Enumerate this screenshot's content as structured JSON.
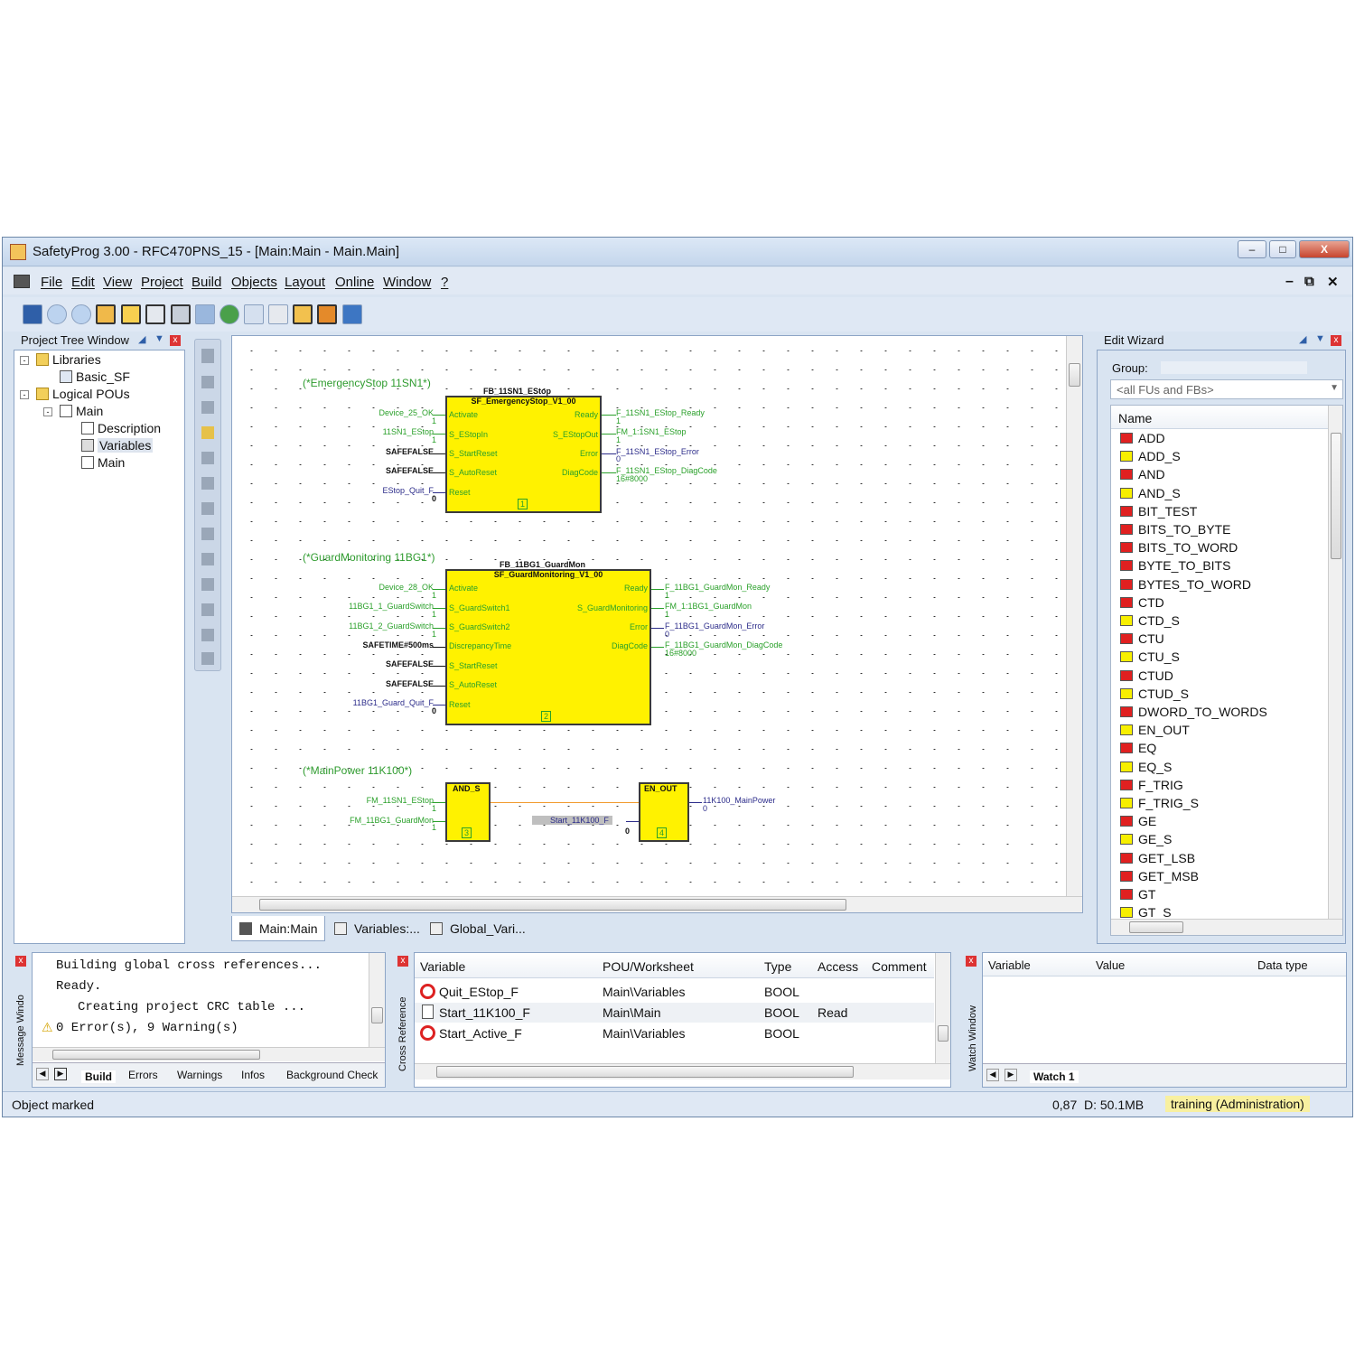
{
  "window": {
    "title": "SafetyProg 3.00 - RFC470PNS_15 - [Main:Main - Main.Main]",
    "controls": {
      "minimize": "–",
      "maximize": "□",
      "close": "X"
    }
  },
  "menu": {
    "items": [
      "File",
      "Edit",
      "View",
      "Project",
      "Build",
      "Objects",
      "Layout",
      "Online",
      "Window",
      "?"
    ],
    "mdi_controls": {
      "minimize": "–",
      "restore": "⧉",
      "close": "✕"
    }
  },
  "project_tree": {
    "title": "Project Tree Window",
    "nodes": {
      "libraries": "Libraries",
      "basic_sf": "Basic_SF",
      "logical_pous": "Logical POUs",
      "main": "Main",
      "description": "Description",
      "variables": "Variables",
      "main_sheet": "Main"
    }
  },
  "editor": {
    "networks": {
      "estop": {
        "comment": "(*EmergencyStop 11SN1*)",
        "instance": "FB_11SN1_EStop",
        "type": "SF_EmergencyStop_V1_00",
        "number": "1",
        "inputs": [
          {
            "var": "Device_25_OK",
            "pin": "Activate",
            "val": "1"
          },
          {
            "var": "11SN1_EStop",
            "pin": "S_EStopIn",
            "val": "1"
          },
          {
            "var": "SAFEFALSE",
            "pin": "S_StartReset",
            "val": ""
          },
          {
            "var": "SAFEFALSE",
            "pin": "S_AutoReset",
            "val": ""
          },
          {
            "var": "EStop_Quit_F",
            "pin": "Reset",
            "val": "0"
          }
        ],
        "outputs": [
          {
            "pin": "Ready",
            "var": "F_11SN1_EStop_Ready",
            "val": "1"
          },
          {
            "pin": "S_EStopOut",
            "var": "FM_1:1SN1_EStop",
            "val": "1"
          },
          {
            "pin": "Error",
            "var": "F_11SN1_EStop_Error",
            "val": "0"
          },
          {
            "pin": "DiagCode",
            "var": "F_11SN1_EStop_DiagCode",
            "val": "16#8000"
          }
        ]
      },
      "guard": {
        "comment": "(*GuardMonitoring 11BG1*)",
        "instance": "FB_11BG1_GuardMon",
        "type": "SF_GuardMonitoring_V1_00",
        "number": "2",
        "inputs": [
          {
            "var": "Device_28_OK",
            "pin": "Activate",
            "val": "1"
          },
          {
            "var": "11BG1_1_GuardSwitch",
            "pin": "S_GuardSwitch1",
            "val": "1"
          },
          {
            "var": "11BG1_2_GuardSwitch",
            "pin": "S_GuardSwitch2",
            "val": "1"
          },
          {
            "var": "SAFETIME#500ms",
            "pin": "DiscrepancyTime",
            "val": ""
          },
          {
            "var": "SAFEFALSE",
            "pin": "S_StartReset",
            "val": ""
          },
          {
            "var": "SAFEFALSE",
            "pin": "S_AutoReset",
            "val": ""
          },
          {
            "var": "11BG1_Guard_Quit_F",
            "pin": "Reset",
            "val": "0"
          }
        ],
        "outputs": [
          {
            "pin": "Ready",
            "var": "F_11BG1_GuardMon_Ready",
            "val": "1"
          },
          {
            "pin": "S_GuardMonitoring",
            "var": "FM_1:1BG1_GuardMon",
            "val": "1"
          },
          {
            "pin": "Error",
            "var": "F_11BG1_GuardMon_Error",
            "val": "0"
          },
          {
            "pin": "DiagCode",
            "var": "F_11BG1_GuardMon_DiagCode",
            "val": "16#8000"
          }
        ]
      },
      "mainpower": {
        "comment": "(*MainPower 11K100*)",
        "and_label": "AND_S",
        "and_number": "3",
        "and_in1": "FM_11SN1_EStop",
        "and_in1_val": "1",
        "and_in2": "FM_11BG1_GuardMon",
        "and_in2_val": "1",
        "en_label": "EN_OUT",
        "en_number": "4",
        "en_in": "Start_11K100_F",
        "en_in_val": "0",
        "en_out": "11K100_MainPower",
        "en_out_val": "0"
      }
    },
    "tabs": [
      "Main:Main",
      "Variables:...",
      "Global_Vari..."
    ]
  },
  "edit_wizard": {
    "title": "Edit Wizard",
    "group_label": "Group:",
    "group_value": "<all FUs and FBs>",
    "column_name": "Name",
    "items": [
      {
        "name": "ADD",
        "color": "red"
      },
      {
        "name": "ADD_S",
        "color": "yellow"
      },
      {
        "name": "AND",
        "color": "red"
      },
      {
        "name": "AND_S",
        "color": "yellow"
      },
      {
        "name": "BIT_TEST",
        "color": "red"
      },
      {
        "name": "BITS_TO_BYTE",
        "color": "red"
      },
      {
        "name": "BITS_TO_WORD",
        "color": "red"
      },
      {
        "name": "BYTE_TO_BITS",
        "color": "red"
      },
      {
        "name": "BYTES_TO_WORD",
        "color": "red"
      },
      {
        "name": "CTD",
        "color": "red"
      },
      {
        "name": "CTD_S",
        "color": "yellow"
      },
      {
        "name": "CTU",
        "color": "red"
      },
      {
        "name": "CTU_S",
        "color": "yellow"
      },
      {
        "name": "CTUD",
        "color": "red"
      },
      {
        "name": "CTUD_S",
        "color": "yellow"
      },
      {
        "name": "DWORD_TO_WORDS",
        "color": "red"
      },
      {
        "name": "EN_OUT",
        "color": "yellow"
      },
      {
        "name": "EQ",
        "color": "red"
      },
      {
        "name": "EQ_S",
        "color": "yellow"
      },
      {
        "name": "F_TRIG",
        "color": "red"
      },
      {
        "name": "F_TRIG_S",
        "color": "yellow"
      },
      {
        "name": "GE",
        "color": "red"
      },
      {
        "name": "GE_S",
        "color": "yellow"
      },
      {
        "name": "GET_LSB",
        "color": "red"
      },
      {
        "name": "GET_MSB",
        "color": "red"
      },
      {
        "name": "GT",
        "color": "red"
      },
      {
        "name": "GT_S",
        "color": "yellow"
      }
    ]
  },
  "message_window": {
    "title": "Message Windo",
    "lines": [
      "Building global cross references...",
      "Ready.",
      "Creating project CRC table ...",
      "0 Error(s), 9 Warning(s)"
    ],
    "tabs": [
      "Build",
      "Errors",
      "Warnings",
      "Infos",
      "Background Check"
    ]
  },
  "cross_reference": {
    "title": "Cross Reference",
    "columns": [
      "Variable",
      "POU/Worksheet",
      "Type",
      "Access",
      "Comment"
    ],
    "rows": [
      {
        "variable": "Quit_EStop_F",
        "pou": "Main\\Variables",
        "type": "BOOL",
        "access": "",
        "comment": "",
        "icon": "forbidden"
      },
      {
        "variable": "Start_11K100_F",
        "pou": "Main\\Main",
        "type": "BOOL",
        "access": "Read",
        "comment": "",
        "icon": "doc"
      },
      {
        "variable": "Start_Active_F",
        "pou": "Main\\Variables",
        "type": "BOOL",
        "access": "",
        "comment": "",
        "icon": "forbidden"
      }
    ]
  },
  "watch_window": {
    "title": "Watch Window",
    "columns": [
      "Variable",
      "Value",
      "Data type"
    ],
    "tab": "Watch 1"
  },
  "status": {
    "left": "Object marked",
    "zoom": "0,87",
    "memory": "D: 50.1MB",
    "user": "training (Administration)"
  },
  "colors": {
    "fb_fill": "#fff200",
    "pin_green": "#2aa02a",
    "pin_blue": "#2c2c8a",
    "comment_green": "#2e9b2e"
  }
}
